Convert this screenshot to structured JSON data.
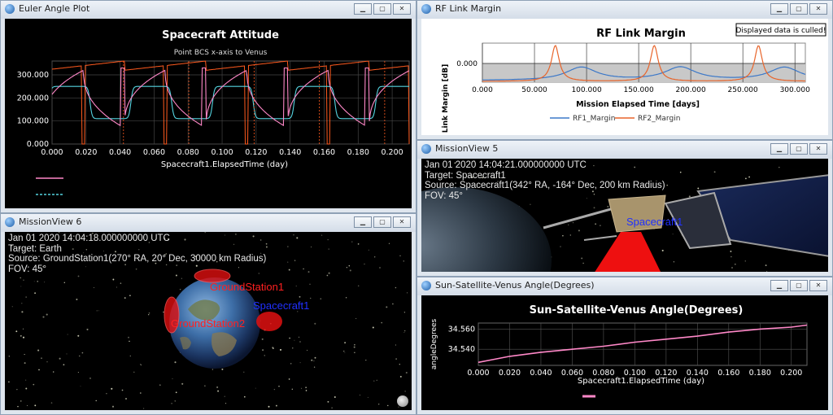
{
  "windows": {
    "euler": {
      "title": "Euler Angle Plot",
      "plot_title": "Spacecraft Attitude",
      "subtitle": "Point BCS x-axis to Venus",
      "xlabel": "Spacecraft1.ElapsedTime (day)",
      "yticks": [
        "300.000",
        "200.000",
        "100.000",
        "0.000"
      ],
      "xticks": [
        "0.000",
        "0.020",
        "0.040",
        "0.060",
        "0.080",
        "0.100",
        "0.120",
        "0.140",
        "0.160",
        "0.180",
        "0.200"
      ],
      "colors": {
        "axis1": "#ff88c8",
        "axis2": "#54d4e0",
        "axis3": "#ff5a1e"
      }
    },
    "rf": {
      "title": "RF Link Margin",
      "plot_title": "RF Link Margin",
      "notice": "Displayed data is culled!",
      "ylabel": "Link Margin [dB]",
      "ytick": "0.000",
      "xlabel": "Mission Elapsed Time [days]",
      "xticks": [
        "0.000",
        "50.000",
        "100.000",
        "150.000",
        "200.000",
        "250.000",
        "300.000"
      ],
      "legend": [
        "RF1_Margin",
        "RF2_Margin"
      ],
      "colors": {
        "rf1": "#3c78c8",
        "rf2": "#e8642a"
      }
    },
    "mv6": {
      "title": "MissionView 6",
      "info": [
        "Jan 01 2020 14:04:18.000000000 UTC",
        "Target: Earth",
        "Source: GroundStation1(270° RA, 20° Dec, 30000 km Radius)",
        "FOV: 45°"
      ],
      "labels": {
        "gs1": "GroundStation1",
        "gs2": "GroundStation2",
        "sc": "Spacecraft1"
      }
    },
    "mv5": {
      "title": "MissionView 5",
      "info": [
        "Jan 01 2020 14:04:21.000000000 UTC",
        "Target: Spacecraft1",
        "Source: Spacecraft1(342° RA, -164° Dec, 200 km Radius)",
        "FOV: 45°"
      ],
      "label": "Spacecraft1"
    },
    "ssv": {
      "title": "Sun-Satellite-Venus Angle(Degrees)",
      "plot_title": "Sun-Satellite-Venus  Angle(Degrees)",
      "ylabel": "angleDegrees",
      "yticks": [
        "34.560",
        "34.540"
      ],
      "xlabel": "Spacecraft1.ElapsedTime (day)",
      "xticks": [
        "0.000",
        "0.020",
        "0.040",
        "0.060",
        "0.080",
        "0.100",
        "0.120",
        "0.140",
        "0.160",
        "0.180",
        "0.200"
      ],
      "color": "#ff88c8"
    }
  },
  "chart_data": [
    {
      "type": "line",
      "title": "Spacecraft Attitude",
      "subtitle": "Point BCS x-axis to Venus",
      "xlabel": "Spacecraft1.ElapsedTime (day)",
      "xlim": [
        0,
        0.21
      ],
      "ylim": [
        0,
        360
      ],
      "grid": true
    },
    {
      "type": "line",
      "title": "RF Link Margin",
      "xlabel": "Mission Elapsed Time [days]",
      "ylabel": "Link Margin [dB]",
      "xlim": [
        0,
        310
      ],
      "legend": "bottom",
      "series": [
        {
          "name": "RF1_Margin",
          "peaks_x": [
            95,
            190,
            290
          ]
        },
        {
          "name": "RF2_Margin",
          "peaks_x": [
            70,
            165,
            265
          ]
        }
      ]
    },
    {
      "type": "line",
      "title": "Sun-Satellite-Venus  Angle(Degrees)",
      "xlabel": "Spacecraft1.ElapsedTime (day)",
      "ylabel": "angleDegrees",
      "xlim": [
        0,
        0.21
      ],
      "x": [
        0.0,
        0.01,
        0.02,
        0.04,
        0.06,
        0.08,
        0.1,
        0.12,
        0.14,
        0.16,
        0.18,
        0.2,
        0.21
      ],
      "y": [
        34.527,
        34.53,
        34.533,
        34.537,
        34.54,
        34.543,
        34.547,
        34.55,
        34.553,
        34.557,
        34.56,
        34.562,
        34.564
      ],
      "grid": true
    }
  ]
}
